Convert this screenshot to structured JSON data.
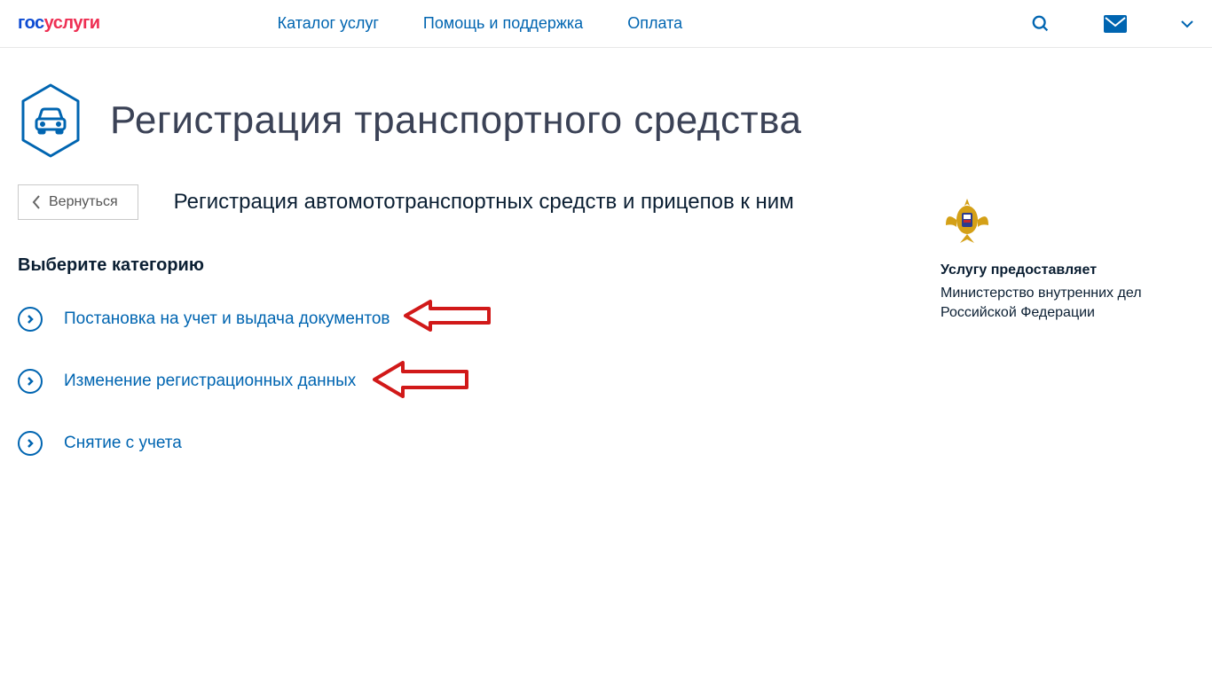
{
  "header": {
    "nav": {
      "catalog": "Каталог услуг",
      "support": "Помощь и поддержка",
      "payment": "Оплата"
    }
  },
  "page": {
    "title": "Регистрация транспортного средства",
    "back": "Вернуться",
    "subtitle": "Регистрация автомототранспортных средств и прицепов к ним",
    "choose": "Выберите категорию"
  },
  "categories": {
    "item0": "Постановка на учет и выдача документов",
    "item1": "Изменение регистрационных данных",
    "item2": "Снятие с учета"
  },
  "provider": {
    "label": "Услугу предоставляет",
    "name": "Министерство внутренних дел Российской Федерации"
  }
}
